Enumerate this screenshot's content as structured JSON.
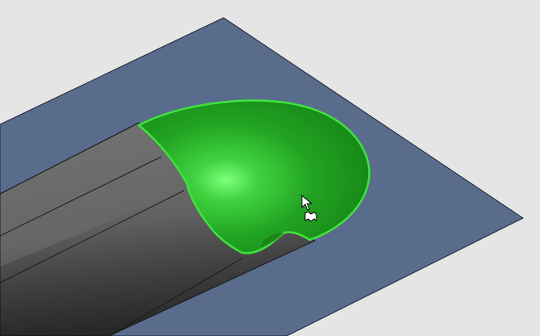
{
  "viewport": {
    "background": "#e5e5e5"
  },
  "scene": {
    "plane_color": "#596c8c",
    "plane_edge_color": "#1c2330",
    "body_color": "#6b6b6b",
    "body_dark_color": "#3e3e3e",
    "body_edge_color": "#1a1a1a",
    "selected_face_color": "#22a322",
    "selected_face_highlight": "#7cff7c",
    "selected_face_edge": "#3ee43e"
  },
  "cursor": {
    "icon": "arrow-pointer-icon",
    "badge_icon": "select-face-filter-icon"
  }
}
